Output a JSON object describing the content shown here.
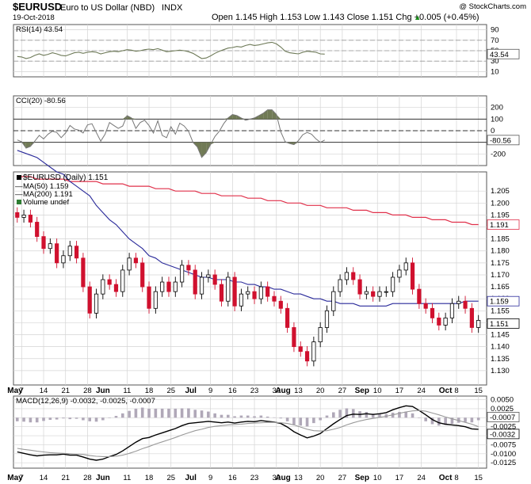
{
  "header": {
    "symbol": "$EURUSD",
    "name": "Euro to US Dollar (NBD)",
    "exchange": "INDX",
    "date": "19-Oct-2018",
    "watermark": "@ StockCharts.com",
    "ohlc": "Open 1.145  High 1.153  Low 1.143  Close 1.151  Chg +0.005 (+0.45%)",
    "chg_arrow": "▲"
  },
  "colors": {
    "up": "#000000",
    "down": "#d0102e",
    "ma50": "#2a2a9a",
    "ma200": "#e0304a",
    "cci_fill": "#707a55",
    "rsi_line": "#6e7a58",
    "macd_hist": "#b0a8b8",
    "grid": "#d4d4d4",
    "panel_bg": "#f6f6f6"
  },
  "chart_data": [
    {
      "type": "line",
      "title": "RSI(14) 43.54",
      "legend": "RSI(14) 43.54",
      "badge": "43.54",
      "value": 43.54,
      "yticks": [
        "90",
        "70",
        "50",
        "30",
        "10"
      ],
      "ylim": [
        0,
        100
      ],
      "reference_lines": [
        70,
        50,
        30
      ],
      "values": [
        39,
        38,
        35,
        37,
        41,
        44,
        41,
        43,
        46,
        44,
        41,
        40,
        43,
        46,
        47,
        45,
        47,
        48,
        47,
        44,
        46,
        48,
        49,
        48,
        50,
        52,
        51,
        49,
        50,
        52,
        53,
        52,
        54,
        51,
        48,
        49,
        50,
        51,
        50,
        48,
        45,
        40,
        35,
        36,
        40,
        45,
        49,
        52,
        55,
        56,
        58,
        57,
        60,
        62,
        60,
        61,
        63,
        65,
        66,
        63,
        57,
        49,
        46,
        45,
        44,
        47,
        49,
        48,
        47,
        44,
        43.54
      ]
    },
    {
      "type": "area",
      "title": "CCI(20) -80.56",
      "legend": "CCI(20) -80.56",
      "badge": "-80.56",
      "value": -80.56,
      "yticks": [
        "200",
        "100",
        "0",
        "-100",
        "-200"
      ],
      "ylim": [
        -300,
        300
      ],
      "reference_lines": [
        100,
        0,
        -100
      ],
      "values": [
        -80,
        -95,
        -150,
        -135,
        -90,
        -40,
        -70,
        -30,
        -5,
        -15,
        -60,
        -20,
        45,
        15,
        5,
        -20,
        50,
        60,
        -15,
        -90,
        -30,
        70,
        45,
        20,
        40,
        130,
        110,
        20,
        70,
        90,
        45,
        -20,
        85,
        -40,
        -60,
        35,
        -30,
        65,
        40,
        -5,
        -100,
        -140,
        -230,
        -190,
        -120,
        -50,
        -5,
        60,
        110,
        140,
        130,
        110,
        90,
        100,
        110,
        130,
        150,
        180,
        180,
        140,
        -10,
        -95,
        -110,
        -120,
        -85,
        -35,
        -15,
        -30,
        -70,
        -100,
        -80.56
      ]
    },
    {
      "type": "bar",
      "title": "$EURUSD (Daily) 1.151",
      "legend": [
        {
          "label": "$EURUSD (Daily) 1.151"
        },
        {
          "label": "MA(50) 1.159"
        },
        {
          "label": "MA(200) 1.191"
        },
        {
          "label": "Volume undef"
        }
      ],
      "yticks": [
        "1.205",
        "1.200",
        "1.195",
        "1.190",
        "1.185",
        "1.180",
        "1.175",
        "1.170",
        "1.165",
        "1.160",
        "1.155",
        "1.150",
        "1.145",
        "1.140",
        "1.135",
        "1.130"
      ],
      "ylim": [
        1.124,
        1.213
      ],
      "badges": [
        {
          "label": "1.191",
          "value": 1.191
        },
        {
          "label": "1.159",
          "value": 1.159
        },
        {
          "label": "1.151",
          "value": 1.151
        }
      ],
      "close": [
        1.194,
        1.195,
        1.192,
        1.186,
        1.181,
        1.183,
        1.175,
        1.178,
        1.182,
        1.177,
        1.165,
        1.154,
        1.162,
        1.168,
        1.166,
        1.163,
        1.172,
        1.177,
        1.175,
        1.165,
        1.156,
        1.163,
        1.167,
        1.163,
        1.167,
        1.174,
        1.172,
        1.162,
        1.169,
        1.17,
        1.166,
        1.159,
        1.169,
        1.157,
        1.162,
        1.163,
        1.16,
        1.165,
        1.161,
        1.159,
        1.156,
        1.148,
        1.14,
        1.138,
        1.134,
        1.142,
        1.148,
        1.155,
        1.163,
        1.168,
        1.171,
        1.168,
        1.162,
        1.163,
        1.161,
        1.163,
        1.163,
        1.169,
        1.172,
        1.175,
        1.164,
        1.158,
        1.156,
        1.152,
        1.149,
        1.152,
        1.158,
        1.159,
        1.156,
        1.148,
        1.151
      ],
      "ma50": [
        1.222,
        1.221,
        1.22,
        1.219,
        1.217,
        1.215,
        1.213,
        1.212,
        1.209,
        1.207,
        1.205,
        1.203,
        1.199,
        1.196,
        1.193,
        1.191,
        1.188,
        1.185,
        1.183,
        1.181,
        1.178,
        1.177,
        1.175,
        1.174,
        1.173,
        1.172,
        1.171,
        1.17,
        1.169,
        1.169,
        1.168,
        1.168,
        1.168,
        1.167,
        1.167,
        1.166,
        1.166,
        1.165,
        1.165,
        1.164,
        1.164,
        1.163,
        1.162,
        1.162,
        1.161,
        1.16,
        1.16,
        1.159,
        1.159,
        1.158,
        1.158,
        1.158,
        1.157,
        1.157,
        1.157,
        1.157,
        1.157,
        1.158,
        1.158,
        1.158,
        1.158,
        1.158,
        1.158,
        1.158,
        1.158,
        1.158,
        1.158,
        1.158,
        1.159,
        1.159,
        1.159
      ],
      "ma200": [
        1.211,
        1.211,
        1.211,
        1.21,
        1.21,
        1.21,
        1.21,
        1.21,
        1.209,
        1.209,
        1.209,
        1.209,
        1.209,
        1.208,
        1.208,
        1.208,
        1.208,
        1.207,
        1.207,
        1.207,
        1.207,
        1.206,
        1.206,
        1.206,
        1.205,
        1.205,
        1.205,
        1.205,
        1.204,
        1.204,
        1.204,
        1.203,
        1.203,
        1.203,
        1.203,
        1.202,
        1.202,
        1.202,
        1.201,
        1.201,
        1.201,
        1.2,
        1.2,
        1.2,
        1.199,
        1.199,
        1.199,
        1.198,
        1.198,
        1.198,
        1.198,
        1.197,
        1.197,
        1.197,
        1.196,
        1.196,
        1.196,
        1.195,
        1.195,
        1.195,
        1.194,
        1.194,
        1.194,
        1.193,
        1.193,
        1.193,
        1.192,
        1.192,
        1.192,
        1.191,
        1.191
      ]
    },
    {
      "type": "line",
      "title": "MACD(12,26,9) -0.0032, -0.0025, -0.0007",
      "legend": "MACD(12,26,9) -0.0032, -0.0025, -0.0007",
      "yticks": [
        "0.0050",
        "0.0025",
        "0.0000",
        "-0.0025",
        "-0.0050",
        "-0.0075",
        "-0.0100",
        "-0.0125"
      ],
      "ylim": [
        -0.014,
        0.006
      ],
      "badges": [
        {
          "label": "-0.0007",
          "value": -0.0007
        },
        {
          "label": "-0.0032",
          "value": -0.0032
        }
      ],
      "macd": [
        -0.0095,
        -0.0099,
        -0.0103,
        -0.0106,
        -0.0104,
        -0.0103,
        -0.0103,
        -0.0101,
        -0.0104,
        -0.0104,
        -0.0109,
        -0.0115,
        -0.0118,
        -0.0115,
        -0.0108,
        -0.0102,
        -0.0092,
        -0.008,
        -0.0068,
        -0.0058,
        -0.0055,
        -0.0048,
        -0.0042,
        -0.0036,
        -0.003,
        -0.0022,
        -0.0016,
        -0.0014,
        -0.0012,
        -0.001,
        -0.0012,
        -0.0014,
        -0.0012,
        -0.0015,
        -0.0012,
        -0.001,
        -0.0011,
        -0.0008,
        -0.001,
        -0.0012,
        -0.0016,
        -0.0026,
        -0.0039,
        -0.0048,
        -0.0056,
        -0.0051,
        -0.0044,
        -0.003,
        -0.0017,
        -0.0005,
        0.0006,
        0.001,
        0.0009,
        0.0011,
        0.0009,
        0.0011,
        0.0014,
        0.0022,
        0.0028,
        0.0033,
        0.0031,
        0.002,
        0.0008,
        -0.0005,
        -0.0014,
        -0.0018,
        -0.002,
        -0.0022,
        -0.0025,
        -0.0031,
        -0.0032
      ],
      "signal": [
        -0.0085,
        -0.0088,
        -0.009,
        -0.0093,
        -0.0095,
        -0.0097,
        -0.0098,
        -0.0099,
        -0.01,
        -0.0101,
        -0.0102,
        -0.0105,
        -0.0107,
        -0.0108,
        -0.0108,
        -0.0107,
        -0.0104,
        -0.0099,
        -0.0093,
        -0.0086,
        -0.008,
        -0.0073,
        -0.0067,
        -0.0061,
        -0.0055,
        -0.0048,
        -0.0042,
        -0.0036,
        -0.0032,
        -0.0027,
        -0.0024,
        -0.0022,
        -0.002,
        -0.0019,
        -0.0018,
        -0.0016,
        -0.0015,
        -0.0014,
        -0.0013,
        -0.0013,
        -0.0014,
        -0.0016,
        -0.002,
        -0.0026,
        -0.0032,
        -0.0036,
        -0.0037,
        -0.0036,
        -0.0032,
        -0.0027,
        -0.002,
        -0.0014,
        -0.0009,
        -0.0005,
        -0.0002,
        0.0001,
        0.0004,
        0.0008,
        0.0012,
        0.0016,
        0.0019,
        0.002,
        0.0018,
        0.0013,
        0.0008,
        0.0002,
        -0.0003,
        -0.0008,
        -0.0013,
        -0.0018,
        -0.0025
      ]
    }
  ],
  "x_axis": {
    "labels": [
      {
        "label": "May",
        "idx": -0.5,
        "bold": true
      },
      {
        "label": "7",
        "idx": 1
      },
      {
        "label": "14",
        "idx": 6
      },
      {
        "label": "21",
        "idx": 11
      },
      {
        "label": "28",
        "idx": 16
      },
      {
        "label": "Jun",
        "idx": 19.5,
        "bold": true
      },
      {
        "label": "11",
        "idx": 25
      },
      {
        "label": "18",
        "idx": 30
      },
      {
        "label": "25",
        "idx": 35
      },
      {
        "label": "Jul",
        "idx": 39.5,
        "bold": true
      },
      {
        "label": "9",
        "idx": 44
      },
      {
        "label": "16",
        "idx": 49
      },
      {
        "label": "23",
        "idx": 54
      },
      {
        "label": "30",
        "idx": 59
      },
      {
        "label": "Aug",
        "idx": 60.5,
        "bold": true
      },
      {
        "label": "13",
        "idx": 64
      },
      {
        "label": "20",
        "idx": 69
      },
      {
        "label": "27",
        "idx": 74
      },
      {
        "label": "Sep",
        "idx": 78.5,
        "bold": true
      },
      {
        "label": "10",
        "idx": 82
      },
      {
        "label": "17",
        "idx": 87
      },
      {
        "label": "24",
        "idx": 92
      },
      {
        "label": "Oct",
        "idx": 97.5,
        "bold": true
      },
      {
        "label": "8",
        "idx": 100
      },
      {
        "label": "15",
        "idx": 105
      }
    ]
  }
}
